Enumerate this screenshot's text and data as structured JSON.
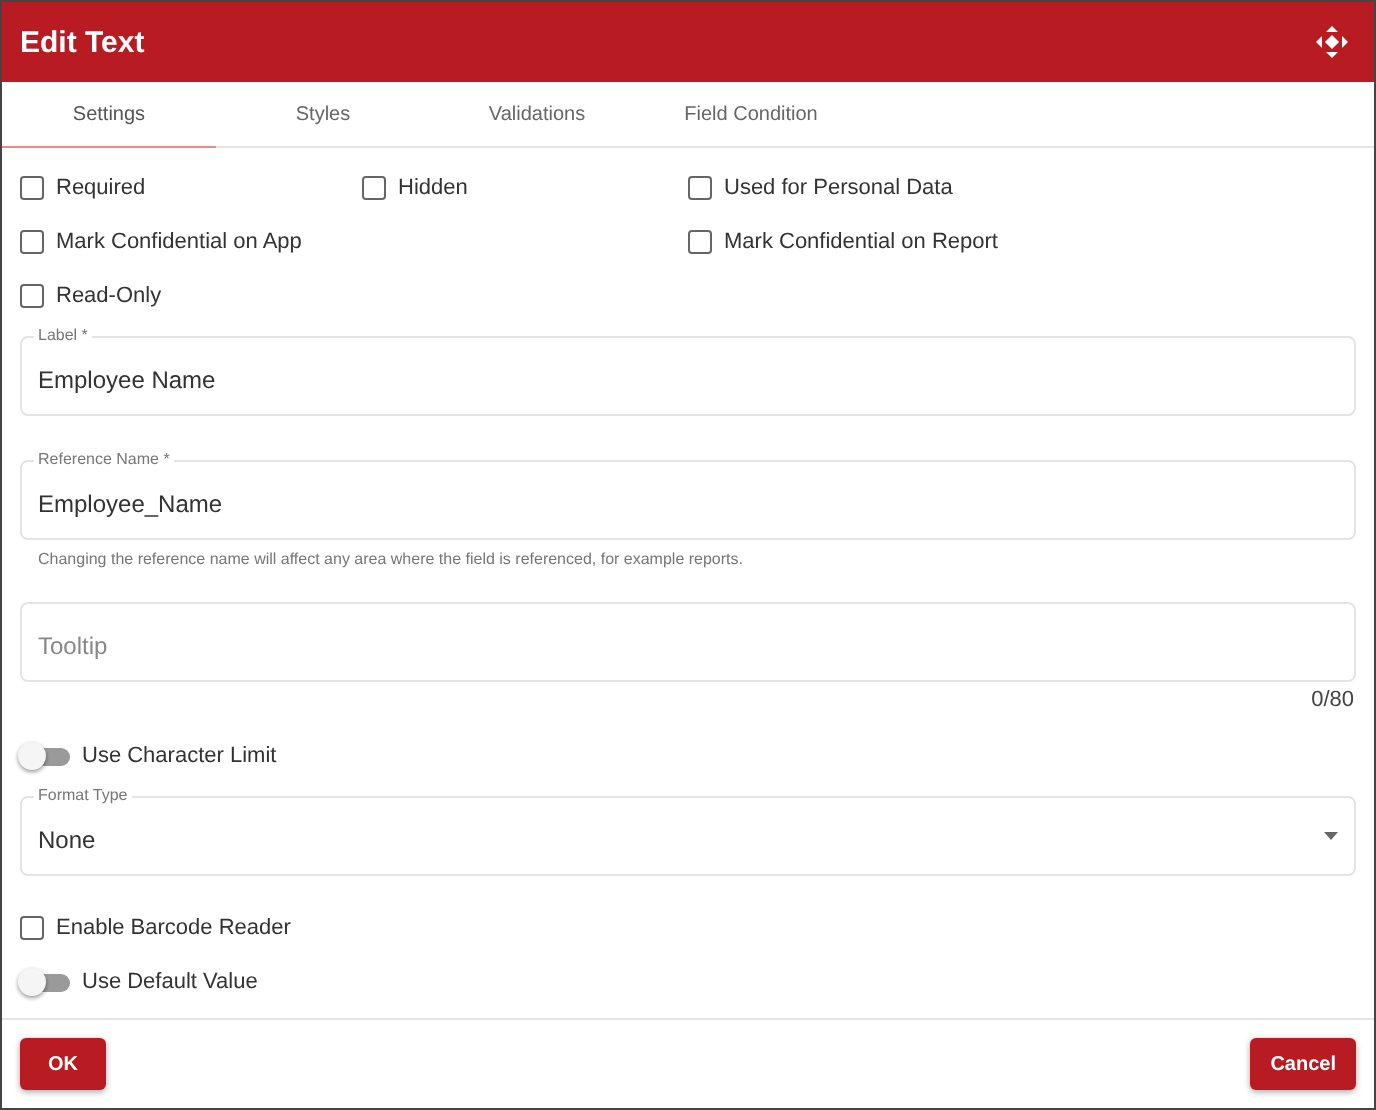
{
  "window": {
    "title": "Edit Text"
  },
  "tabs": [
    {
      "label": "Settings",
      "selected": true
    },
    {
      "label": "Styles",
      "selected": false
    },
    {
      "label": "Validations",
      "selected": false
    },
    {
      "label": "Field Condition",
      "selected": false
    }
  ],
  "checkbox_columns": [
    [
      {
        "label": "Required",
        "checked": false
      },
      {
        "label": "Mark Confidential on App",
        "checked": false
      },
      {
        "label": "Read-Only",
        "checked": false
      }
    ],
    [
      {
        "label": "Hidden",
        "checked": false
      }
    ],
    [
      {
        "label": "Used for Personal Data",
        "checked": false
      },
      {
        "label": "Mark Confidential on Report",
        "checked": false
      }
    ]
  ],
  "fields": [
    {
      "kind": "text",
      "label": "Label *",
      "value": "Employee Name"
    },
    {
      "kind": "text",
      "label": "Reference Name *",
      "value": "Employee_Name",
      "helper": "Changing the reference name will affect any area where the field is referenced, for example reports."
    },
    {
      "kind": "text",
      "placeholder": "Tooltip",
      "counter": "0/80"
    },
    {
      "kind": "toggle",
      "label": "Use Character Limit",
      "on": false
    },
    {
      "kind": "select",
      "label": "Format Type",
      "value": "None"
    },
    {
      "kind": "checkbox",
      "label": "Enable Barcode Reader",
      "checked": false
    },
    {
      "kind": "toggle",
      "label": "Use Default Value",
      "on": false
    }
  ],
  "buttons": [
    {
      "label": "OK"
    },
    {
      "label": "Cancel"
    }
  ]
}
